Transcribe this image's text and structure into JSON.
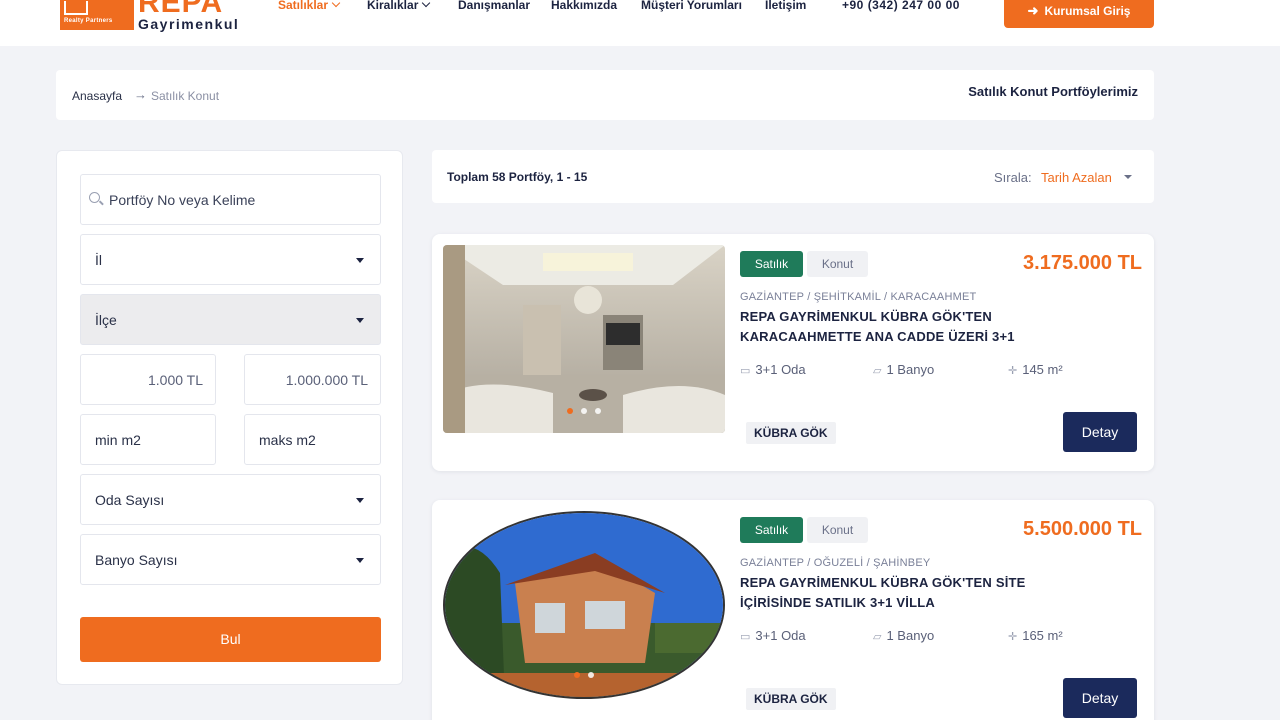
{
  "brand": {
    "name": "REPA",
    "subtitle": "Gayrimenkul",
    "tagline": "Realty Partners",
    "accent": "#ef6c1f",
    "navy": "#1b2a5c",
    "green": "#1f7b5a"
  },
  "nav": {
    "items": [
      {
        "label": "Satılıklar",
        "dropdown": true,
        "active": true
      },
      {
        "label": "Kiralıklar",
        "dropdown": true,
        "active": false
      },
      {
        "label": "Danışmanlar"
      },
      {
        "label": "Hakkımızda"
      },
      {
        "label": "Müşteri Yorumları"
      },
      {
        "label": "İletişim"
      }
    ],
    "phone": "+90 (342) 247 00 00",
    "corporate_login": "Kurumsal Giriş"
  },
  "breadcrumb": {
    "home": "Anasayfa",
    "current": "Satılık Konut",
    "page_title": "Satılık Konut Portföylerimiz"
  },
  "filters": {
    "search_placeholder": "Portföy No veya Kelime",
    "province": "İl",
    "district": "İlçe",
    "price_min": "1.000 TL",
    "price_max": "1.000.000 TL",
    "area_min": "min m2",
    "area_max": "maks m2",
    "rooms": "Oda Sayısı",
    "bathrooms": "Banyo Sayısı",
    "submit": "Bul"
  },
  "listing_header": {
    "total": "Toplam 58 Portföy, 1 - 15",
    "sort_label": "Sırala:",
    "sort_value": "Tarih Azalan"
  },
  "listings": [
    {
      "status": "Satılık",
      "type": "Konut",
      "price": "3.175.000 TL",
      "location": "GAZİANTEP / ŞEHİTKAMİL / KARACAAHMET",
      "title": "REPA GAYRİMENKUL KÜBRA GÖK'TEN KARACAAHMETTE ANA CADDE ÜZERİ 3+1",
      "rooms": "3+1 Oda",
      "baths": "1 Banyo",
      "area": "145 m²",
      "agent": "KÜBRA GÖK",
      "button": "Detay"
    },
    {
      "status": "Satılık",
      "type": "Konut",
      "price": "5.500.000 TL",
      "location": "GAZİANTEP / OĞUZELİ / ŞAHİNBEY",
      "title": "REPA GAYRİMENKUL KÜBRA GÖK'TEN SİTE İÇİRİSİNDE SATILIK 3+1 VİLLA",
      "rooms": "3+1 Oda",
      "baths": "1 Banyo",
      "area": "165 m²",
      "agent": "KÜBRA GÖK",
      "button": "Detay"
    }
  ]
}
